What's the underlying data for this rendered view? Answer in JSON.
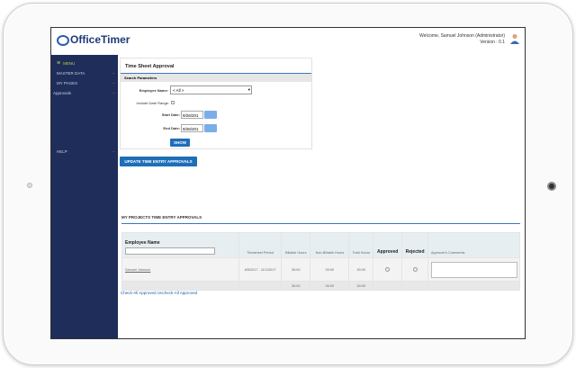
{
  "header": {
    "app_name": "OfficeTimer",
    "welcome": "Welcome, Samuel Johnson (Administrator)",
    "version": "Version : 0.1"
  },
  "sidebar": {
    "menu_label": "MENU",
    "items": [
      {
        "label": "MASTER DATA",
        "arrow": "-"
      },
      {
        "label": "MY PAGES",
        "arrow": "-"
      },
      {
        "label": "Approvals",
        "arrow": "-"
      },
      {
        "label": "HELP",
        "arrow": "-"
      }
    ]
  },
  "panel": {
    "title": "Time Sheet Approval",
    "section": "Search Parameters",
    "employee_label": "Employee Name:",
    "employee_value": "< All >",
    "include_range_label": "Include Date Range:",
    "start_label": "Start Date:",
    "start_value": "9/26/201",
    "end_label": "End Date:",
    "end_value": "9/26/201",
    "show_label": "SHOW"
  },
  "update_button": "UPDATE TIME ENTRY APPROVALS",
  "approvals": {
    "title": "MY PROJECTS TIME ENTRY APPROVALS",
    "columns": [
      "Employee Name",
      "Timesheet Period",
      "Billable Hours",
      "Non-Billable Hours",
      "Total Hours",
      "Approved",
      "Rejected",
      "Approver's Comments"
    ],
    "rows": [
      {
        "employee": "Samuel Johnson",
        "period": "6/5/2017 - 11/1/2017",
        "billable": "30:00",
        "non_billable": "00:00",
        "total": "30:00"
      }
    ],
    "totals": {
      "billable": "30:00",
      "non_billable": "00:00",
      "total": "30:00"
    },
    "check_all": "Check-All Approved",
    "uncheck_all": "Uncheck-All Approved"
  }
}
